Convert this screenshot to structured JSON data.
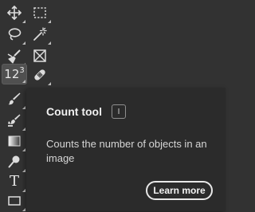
{
  "toolbar": {
    "tools": [
      {
        "name": "move-tool",
        "icon": "move-icon"
      },
      {
        "name": "rectangular-marquee-tool",
        "icon": "marquee-icon"
      },
      {
        "name": "lasso-tool",
        "icon": "lasso-icon"
      },
      {
        "name": "magic-wand-tool",
        "icon": "magic-wand-icon"
      },
      {
        "name": "eyedropper-tool",
        "icon": "eyedropper-icon"
      },
      {
        "name": "frame-tool",
        "icon": "frame-icon"
      },
      {
        "name": "count-tool",
        "icon": "count-icon",
        "label_main": "1",
        "label_mid": "2",
        "label_sup": "3",
        "selected": true
      },
      {
        "name": "healing-brush-tool",
        "icon": "bandage-icon"
      },
      {
        "name": "brush-tool",
        "icon": "brush-icon"
      },
      {
        "name": "clone-stamp-tool",
        "icon": "clone-brush-icon"
      },
      {
        "name": "gradient-tool",
        "icon": "gradient-icon"
      },
      {
        "name": "dodge-tool",
        "icon": "dodge-icon"
      },
      {
        "name": "type-tool",
        "icon": "type-icon",
        "label": "T"
      },
      {
        "name": "rectangle-tool",
        "icon": "rectangle-icon"
      }
    ]
  },
  "tooltip": {
    "title": "Count tool",
    "shortcut": "I",
    "description": "Counts the number of objects in an image",
    "learn_more": "Learn more"
  },
  "colors": {
    "background": "#323232",
    "tooltip_bg": "#2b2b2b",
    "selected_bg": "#505050",
    "icon": "#dcdcdc"
  }
}
